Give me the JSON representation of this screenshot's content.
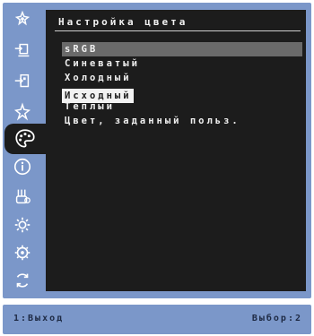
{
  "osd": {
    "title": "Настройка цвета",
    "menu": [
      {
        "label": "sRGB",
        "state": "highlight"
      },
      {
        "label": "Синеватый",
        "state": "normal"
      },
      {
        "label": "Холодный",
        "state": "normal"
      },
      {
        "label": "Исходный",
        "state": "selected"
      },
      {
        "label": "Теплый",
        "state": "normal"
      },
      {
        "label": "Цвет, заданный польз.",
        "state": "normal"
      }
    ],
    "sidebar_icons": [
      "picture-adjust-icon",
      "input-select-icon",
      "brightness-icon",
      "settings-icon",
      "color-palette-icon",
      "info-icon",
      "manual-settings-icon",
      "gear-icon",
      "setup-gear-icon",
      "refresh-icon"
    ],
    "active_sidebar_index": 4
  },
  "footer": {
    "exit_label": "1:Выход",
    "select_label": "Выбор:2"
  }
}
